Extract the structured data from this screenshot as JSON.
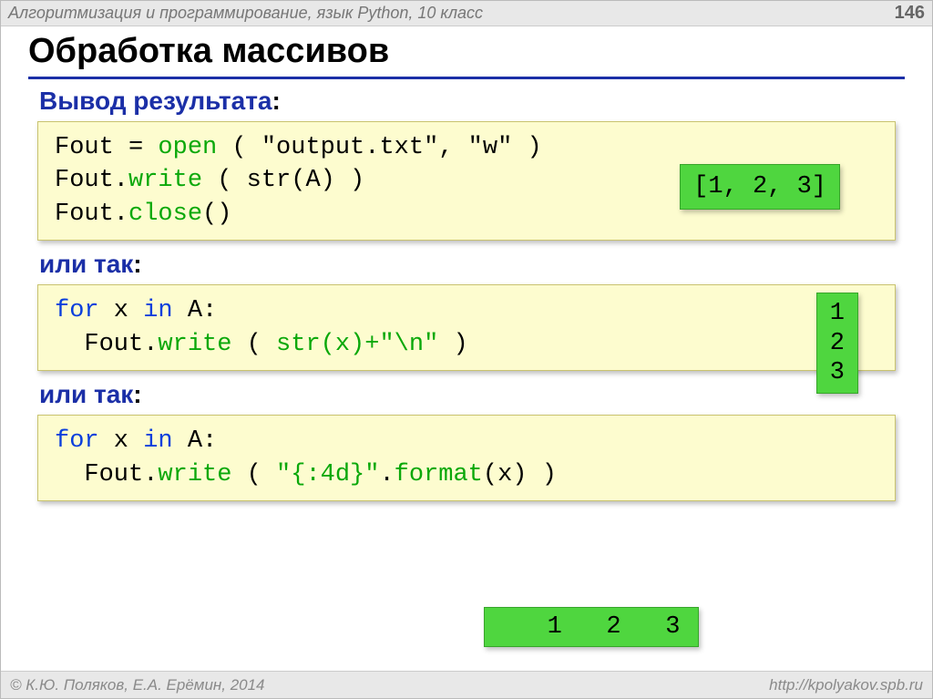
{
  "header": {
    "course": "Алгоритмизация и программирование, язык Python, 10 класс",
    "page": "146"
  },
  "title": "Обработка массивов",
  "sections": {
    "s1_label": "Вывод результата",
    "s2_label": "или так",
    "s3_label": "или так"
  },
  "code": {
    "b1": {
      "l1a": "Fout",
      "l1eq": " = ",
      "l1fn": "open",
      "l1b": " ( \"output.txt\", \"w\" )",
      "l2a": "Fout.",
      "l2fn": "write",
      "l2b": " ( str(A) )",
      "l3a": "Fout.",
      "l3fn": "close",
      "l3b": "()"
    },
    "b2": {
      "l1kw": "for",
      "l1a": " x ",
      "l1kw2": "in",
      "l1b": " A:",
      "l2a": "  Fout.",
      "l2fn": "write",
      "l2b": " ( ",
      "l2arg": "str(x)+\"\\n\"",
      "l2c": " )"
    },
    "b3": {
      "l1kw": "for",
      "l1a": " x ",
      "l1kw2": "in",
      "l1b": " A:",
      "l2a": "  Fout.",
      "l2fn": "write",
      "l2b": " ( ",
      "l2fmt": "\"{:4d}\"",
      "l2dot": ".",
      "l2fn2": "format",
      "l2c": "(x) )"
    }
  },
  "outputs": {
    "o1": "[1, 2, 3]",
    "o2": "1\n2\n3",
    "o3": "   1   2   3"
  },
  "footer": {
    "left": "© К.Ю. Поляков, Е.А. Ерёмин, 2014",
    "right": "http://kpolyakov.spb.ru"
  }
}
